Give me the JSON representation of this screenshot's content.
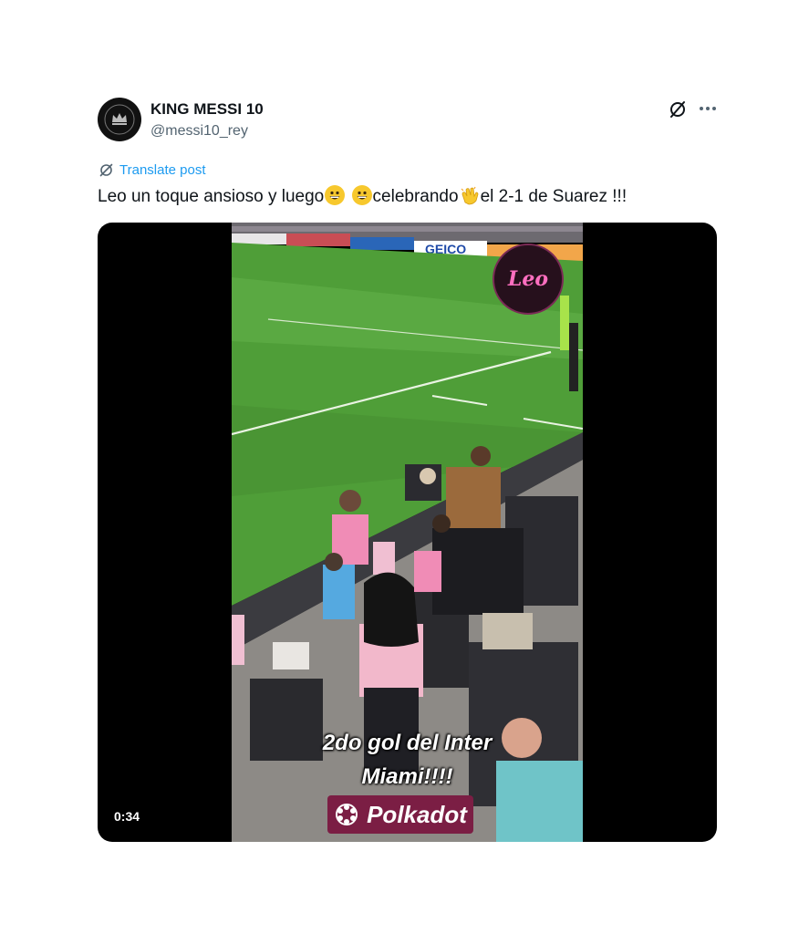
{
  "user": {
    "display_name": "KING MESSI 10",
    "handle": "@messi10_rey"
  },
  "actions": {
    "grok_icon": "grok-icon",
    "more_icon": "more-icon"
  },
  "translate": {
    "label": "Translate post"
  },
  "post": {
    "text_part1": "Leo un toque ansioso y luego",
    "text_part2": "celebrando",
    "text_part3": "el 2-1 de Suarez !!!"
  },
  "video": {
    "duration": "0:34",
    "caption_line1": "2do gol del Inter",
    "caption_line2": "Miami!!!!",
    "watermark_text": "Leo",
    "brand_text": "Polkadot",
    "ad_board": "GEICO"
  },
  "colors": {
    "link": "#1d9bf0",
    "text": "#0f1419",
    "secondary": "#536471"
  }
}
